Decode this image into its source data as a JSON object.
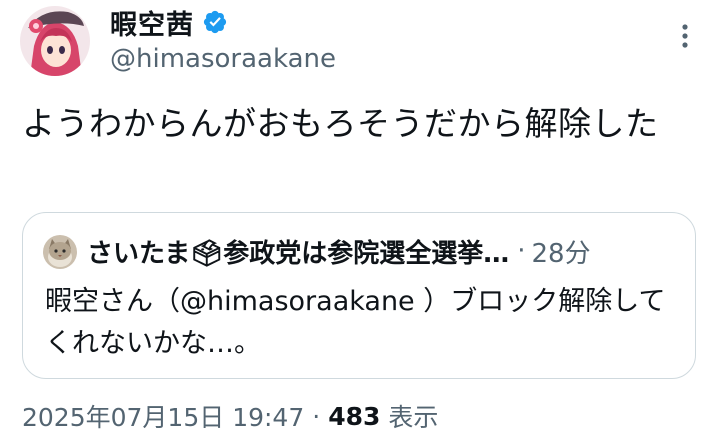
{
  "author": {
    "display_name": "暇空茜",
    "handle": "@himasoraakane",
    "avatar_icon": "anime-girl-avatar",
    "verified_icon": "verified-badge-icon",
    "verified_color": "#1d9bf0"
  },
  "tweet": {
    "text": "ようわからんがおもろそうだから解除した"
  },
  "quote": {
    "name": "さいたま🗳参政党は参院選全選挙…",
    "separator": "·",
    "time": "28分",
    "text": "暇空さん（@himasoraakane ）ブロック解除してくれないかな…。",
    "avatar_icon": "cat-avatar"
  },
  "meta": {
    "datetime": "2025年07月15日 19:47",
    "separator": "·",
    "views": "483",
    "views_label": "表示"
  },
  "colors": {
    "text": "#0f1419",
    "secondary": "#536471",
    "border": "#cfd9de",
    "accent": "#1d9bf0"
  },
  "icons": {
    "more": "more-vertical-icon"
  }
}
